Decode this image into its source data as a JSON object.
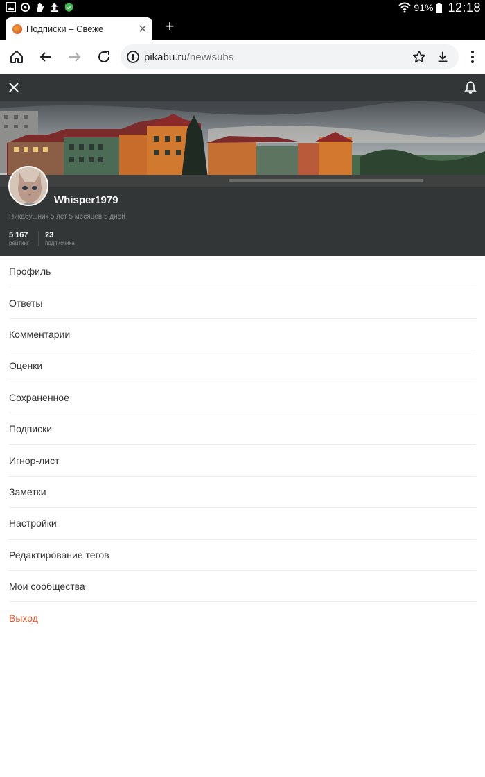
{
  "status_bar": {
    "battery": "91%",
    "time": "12:18"
  },
  "browser": {
    "tab_title": "Подписки – Свеже",
    "url_host": "pikabu.ru",
    "url_path": "/new/subs"
  },
  "profile": {
    "username": "Whisper1979",
    "tenure": "Пикабушник 5 лет 5 месяцев 5 дней",
    "rating_value": "5 167",
    "rating_label": "рейтинг",
    "subscribers_value": "23",
    "subscribers_label": "подписчика"
  },
  "menu": {
    "items": [
      {
        "label": "Профиль"
      },
      {
        "label": "Ответы"
      },
      {
        "label": "Комментарии"
      },
      {
        "label": "Оценки"
      },
      {
        "label": "Сохраненное"
      },
      {
        "label": "Подписки"
      },
      {
        "label": "Игнор-лист"
      },
      {
        "label": "Заметки"
      },
      {
        "label": "Настройки"
      },
      {
        "label": "Редактирование тегов"
      },
      {
        "label": "Мои сообщества"
      },
      {
        "label": "Выход"
      }
    ]
  },
  "colors": {
    "header_bg": "#333636",
    "logout": "#e4572e"
  }
}
